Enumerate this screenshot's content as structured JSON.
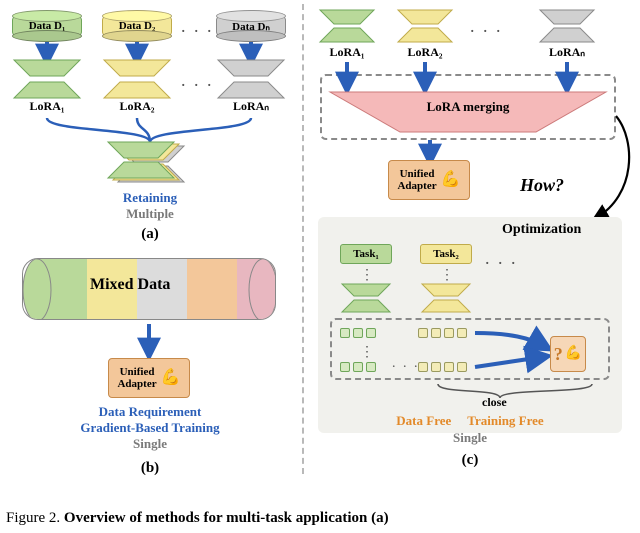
{
  "figure": {
    "number": "Figure 2.",
    "title": "Overview of methods for multi-task application (a)"
  },
  "panelA": {
    "data_cyl": [
      "Data D₁",
      "Data D₂",
      "Data Dₙ"
    ],
    "lora_labels": [
      "LoRA₁",
      "LoRA₂",
      "LoRAₙ"
    ],
    "ellipsis_top": ". . .",
    "ellipsis_mid": ". . .",
    "tag1": "Retaining",
    "tag2": "Multiple",
    "letter": "(a)"
  },
  "panelB": {
    "mixed_label": "Mixed Data",
    "adapter_label": "Unified\nAdapter",
    "bicep": "💪",
    "tag1": "Data Requirement",
    "tag2": "Gradient-Based Training",
    "tag3": "Single",
    "letter": "(b)"
  },
  "panelC": {
    "lora_labels": [
      "LoRA₁",
      "LoRA₂",
      "LoRAₙ"
    ],
    "ellipsis_top": ". . .",
    "merging_label": "LoRA merging",
    "adapter_label": "Unified\nAdapter",
    "bicep": "💪",
    "how_label": "How?",
    "opt_label": "Optimization",
    "task_labels": [
      "Task₁",
      "Task₂"
    ],
    "qmark": "?",
    "close_label": "close",
    "tag1": "Data Free",
    "tag2": "Training Free",
    "tag3": "Single",
    "letter": "(c)"
  },
  "colors": {
    "green": "#b9d99a",
    "yellow": "#f3e79a",
    "gray": "#c8c8c8",
    "orange": "#f3c79a",
    "blue": "#2b5fb8"
  }
}
